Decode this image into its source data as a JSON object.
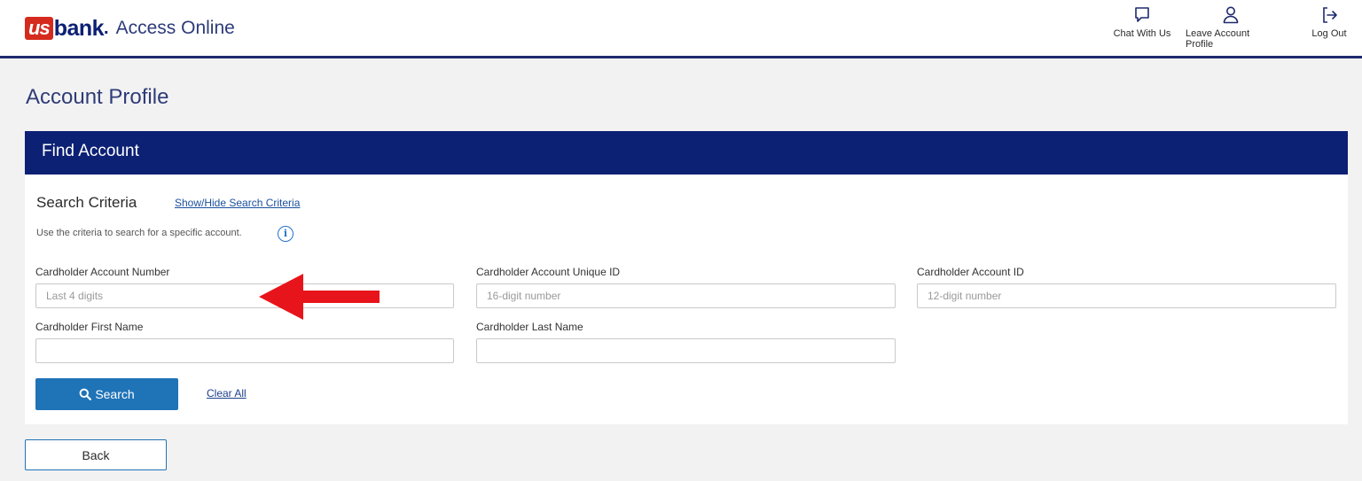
{
  "header": {
    "logo_us": "us",
    "logo_bank": "bank",
    "logo_dot": ".",
    "product_name": "Access Online",
    "actions": {
      "chat": "Chat With Us",
      "leave_profile": "Leave Account Profile",
      "logout": "Log Out"
    }
  },
  "page": {
    "title": "Account Profile"
  },
  "panel": {
    "header": "Find Account",
    "criteria_title": "Search Criteria",
    "toggle_link": "Show/Hide Search Criteria",
    "hint": "Use the criteria to search for a specific account.",
    "info_glyph": "i"
  },
  "fields": {
    "account_number": {
      "label": "Cardholder Account Number",
      "placeholder": "Last 4 digits",
      "value": ""
    },
    "unique_id": {
      "label": "Cardholder Account Unique ID",
      "placeholder": "16-digit number",
      "value": ""
    },
    "account_id": {
      "label": "Cardholder Account ID",
      "placeholder": "12-digit number",
      "value": ""
    },
    "first_name": {
      "label": "Cardholder First Name",
      "placeholder": "",
      "value": ""
    },
    "last_name": {
      "label": "Cardholder Last Name",
      "placeholder": "",
      "value": ""
    }
  },
  "buttons": {
    "search": "Search",
    "clear": "Clear All",
    "back": "Back"
  },
  "icons": {
    "chat": "chat-bubble-icon",
    "person": "person-icon",
    "logout": "logout-icon",
    "search": "magnifier-icon",
    "info": "info-icon",
    "annotation": "red-arrow-icon"
  },
  "colors": {
    "brand_navy": "#0c2074",
    "brand_red": "#d52b1e",
    "button_blue": "#1f73b7",
    "annotation_red": "#e8141b"
  }
}
